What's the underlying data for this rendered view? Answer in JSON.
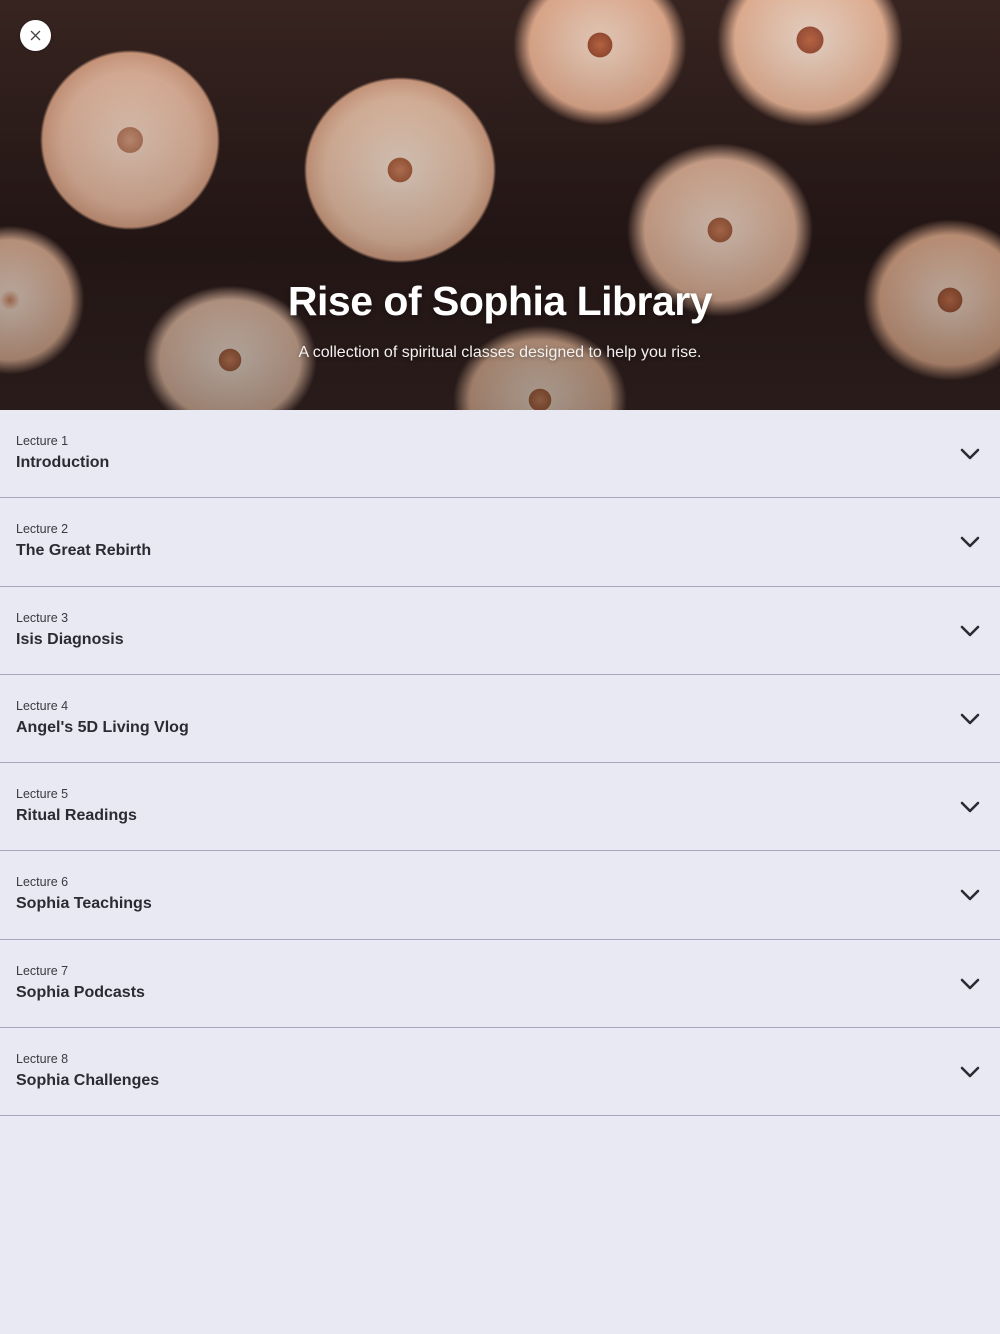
{
  "hero": {
    "title": "Rise of Sophia Library",
    "subtitle": "A collection of spiritual classes designed to help you rise.",
    "close_icon": "close-icon"
  },
  "lectures": [
    {
      "number": "Lecture 1",
      "title": "Introduction"
    },
    {
      "number": "Lecture 2",
      "title": "The Great Rebirth"
    },
    {
      "number": "Lecture 3",
      "title": "Isis Diagnosis"
    },
    {
      "number": "Lecture 4",
      "title": "Angel's 5D Living Vlog"
    },
    {
      "number": "Lecture 5",
      "title": "Ritual Readings"
    },
    {
      "number": "Lecture 6",
      "title": "Sophia Teachings"
    },
    {
      "number": "Lecture 7",
      "title": "Sophia Podcasts"
    },
    {
      "number": "Lecture 8",
      "title": "Sophia Challenges"
    }
  ],
  "colors": {
    "background": "#e9e9f3",
    "divider": "#a6a6bd",
    "text": "#2b2b33"
  }
}
